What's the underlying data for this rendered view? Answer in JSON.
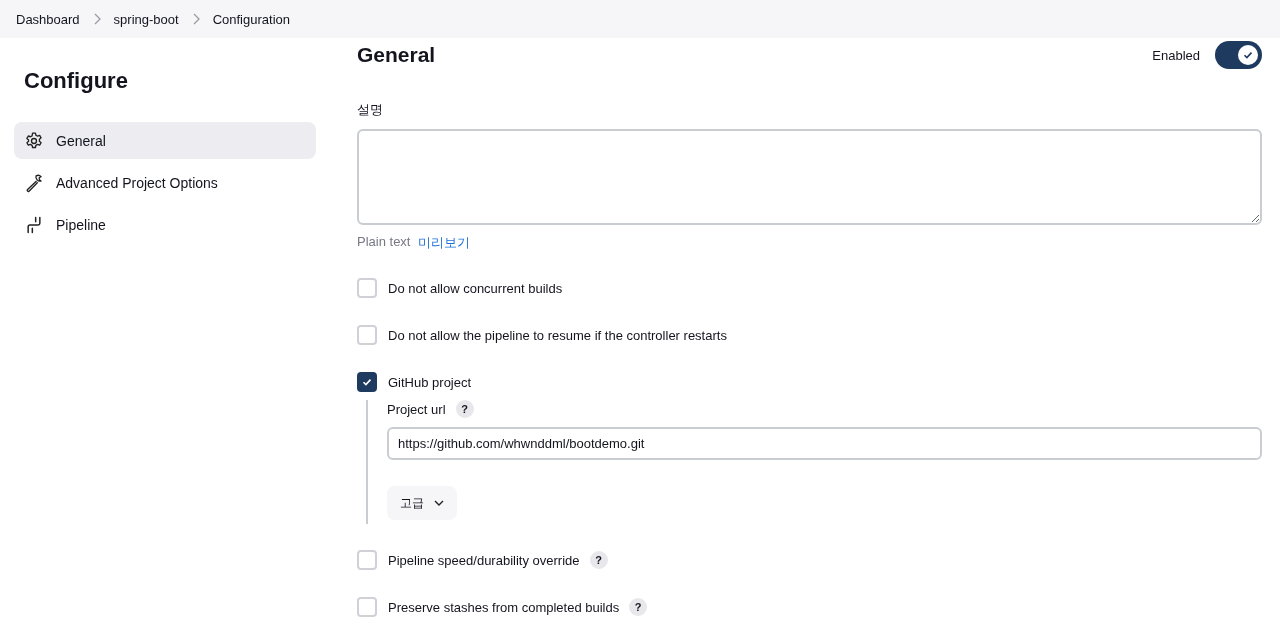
{
  "breadcrumbs": [
    {
      "label": "Dashboard"
    },
    {
      "label": "spring-boot"
    },
    {
      "label": "Configuration"
    }
  ],
  "sidebar": {
    "title": "Configure",
    "items": [
      {
        "label": "General",
        "kind": "gear",
        "selected": true
      },
      {
        "label": "Advanced Project Options",
        "kind": "wrench",
        "selected": false
      },
      {
        "label": "Pipeline",
        "kind": "pipeline",
        "selected": false
      }
    ]
  },
  "section": {
    "title": "General",
    "enabled_label": "Enabled",
    "enabled": true
  },
  "description": {
    "label": "설명",
    "value_format": "Plain text",
    "preview_link": "미리보기"
  },
  "options": [
    {
      "label": "Do not allow concurrent builds",
      "checked": false
    },
    {
      "label": "Do not allow the pipeline to resume if the controller restarts",
      "checked": false
    },
    {
      "label": "GitHub project",
      "checked": true,
      "details": {
        "label": "Project url",
        "help": "?",
        "value": "https://github.com/whwnddml/bootdemo.git",
        "advanced_button": "고급"
      }
    },
    {
      "label": "Pipeline speed/durability override",
      "checked": false,
      "help": "?"
    },
    {
      "label": "Preserve stashes from completed builds",
      "checked": false,
      "help": "?"
    }
  ]
}
